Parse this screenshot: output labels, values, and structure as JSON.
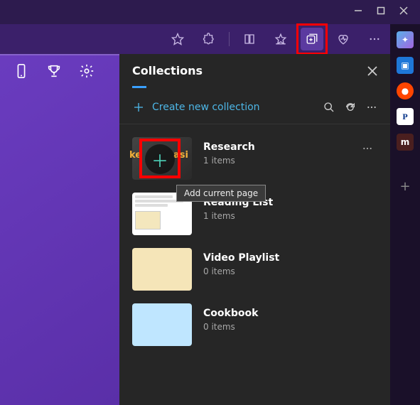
{
  "window_controls": {
    "minimize": "min",
    "maximize": "max",
    "close": "close"
  },
  "toolbar": {
    "favorite": "star-icon",
    "extensions": "puzzle-icon",
    "reading": "book-icon",
    "collections": "collections-icon",
    "performance": "heart-icon",
    "more": "more-icon"
  },
  "right_sidebar": {
    "items": [
      {
        "name": "copilot",
        "bg": "#2b2b3b",
        "glyph": "◆"
      },
      {
        "name": "camera",
        "bg": "#1e77d8",
        "glyph": "▣"
      },
      {
        "name": "reddit",
        "bg": "#ff4500",
        "glyph": "●"
      },
      {
        "name": "paypal",
        "bg": "#fff",
        "glyph": "P"
      },
      {
        "name": "m-app",
        "bg": "#4a1f1f",
        "glyph": "m"
      }
    ],
    "add": "+"
  },
  "left_icons": {
    "phone": "phone",
    "trophy": "trophy",
    "settings": "gear"
  },
  "panel": {
    "title": "Collections",
    "create_label": "Create new collection",
    "search": "search",
    "refresh": "refresh",
    "more": "more"
  },
  "tooltip": "Add current page",
  "collections": [
    {
      "title": "Research",
      "count": "1 items",
      "thumb": "research",
      "show_add": true,
      "show_menu": true
    },
    {
      "title": "Reading List",
      "count": "1 items",
      "thumb": "reading",
      "show_add": false,
      "show_menu": false
    },
    {
      "title": "Video Playlist",
      "count": "0 items",
      "thumb": "video",
      "show_add": false,
      "show_menu": false
    },
    {
      "title": "Cookbook",
      "count": "0 items",
      "thumb": "cookbook",
      "show_add": false,
      "show_menu": false
    }
  ]
}
